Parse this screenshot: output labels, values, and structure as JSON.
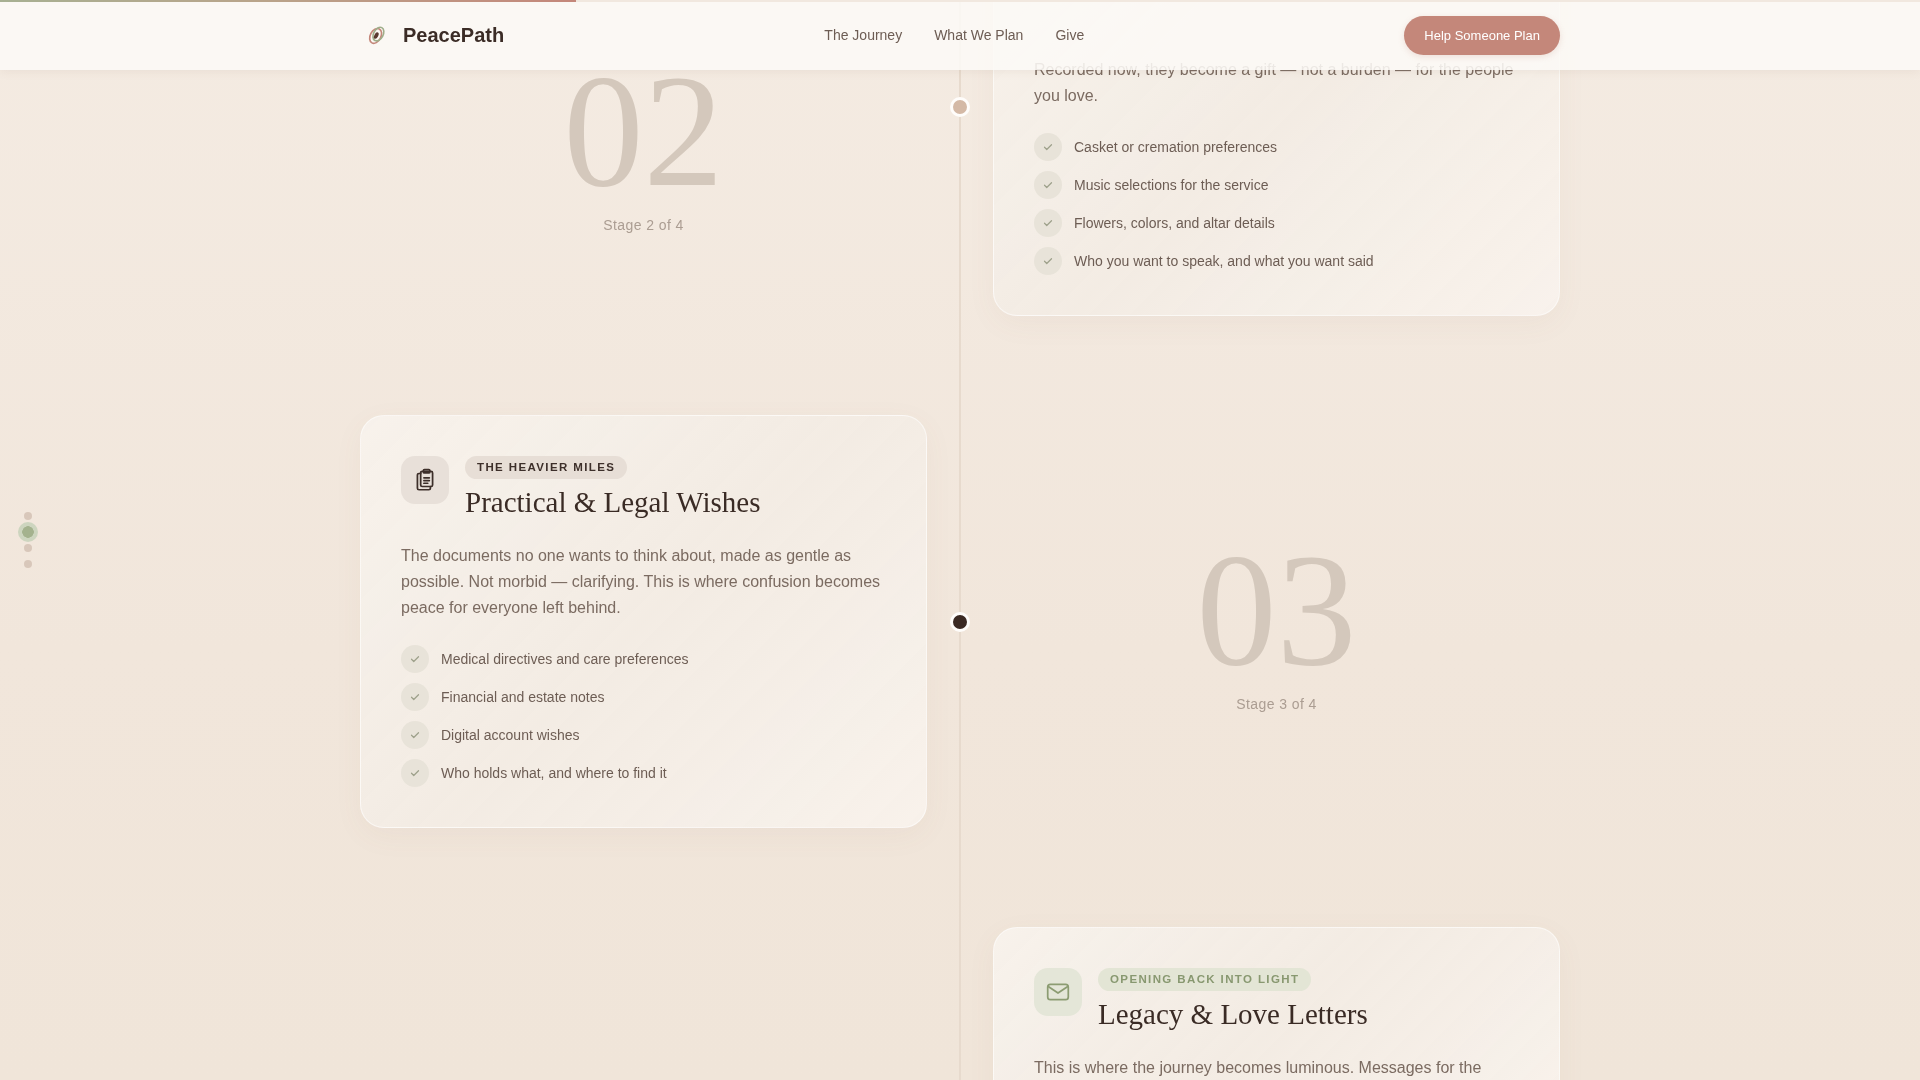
{
  "header": {
    "reading_progress": {
      "level": 0.3
    },
    "brand": "PeacePath",
    "nav": [
      "The Journey",
      "What We Plan",
      "Give"
    ],
    "cta": "Help Someone Plan"
  },
  "section_nav": [
    {
      "selected": false
    },
    {
      "selected": true
    },
    {
      "selected": false
    },
    {
      "selected": false
    }
  ],
  "stages": [
    {
      "number": "02",
      "label": "Stage 2 of 4",
      "dot_active": false,
      "card": {
        "description": "Recorded now, they become a gift — not a burden — for the people you love.",
        "items": [
          "Casket or cremation preferences",
          "Music selections for the service",
          "Flowers, colors, and altar details",
          "Who you want to speak, and what you want said"
        ]
      }
    },
    {
      "number": "03",
      "label": "Stage 3 of 4",
      "dot_active": true,
      "card": {
        "header": {
          "kind": "legal",
          "tag": "THE HEAVIER MILES",
          "title": "Practical & Legal Wishes"
        },
        "description": "The documents no one wants to think about, made as gentle as possible. Not morbid — clarifying. This is where confusion becomes peace for everyone left behind.",
        "items": [
          "Medical directives and care preferences",
          "Financial and estate notes",
          "Digital account wishes",
          "Who holds what, and where to find it"
        ]
      }
    },
    {
      "card": {
        "header": {
          "kind": "letters",
          "tag": "OPENING BACK INTO LIGHT",
          "title": "Legacy & Love Letters"
        },
        "description": "This is where the journey becomes luminous. Messages for the"
      }
    }
  ]
}
